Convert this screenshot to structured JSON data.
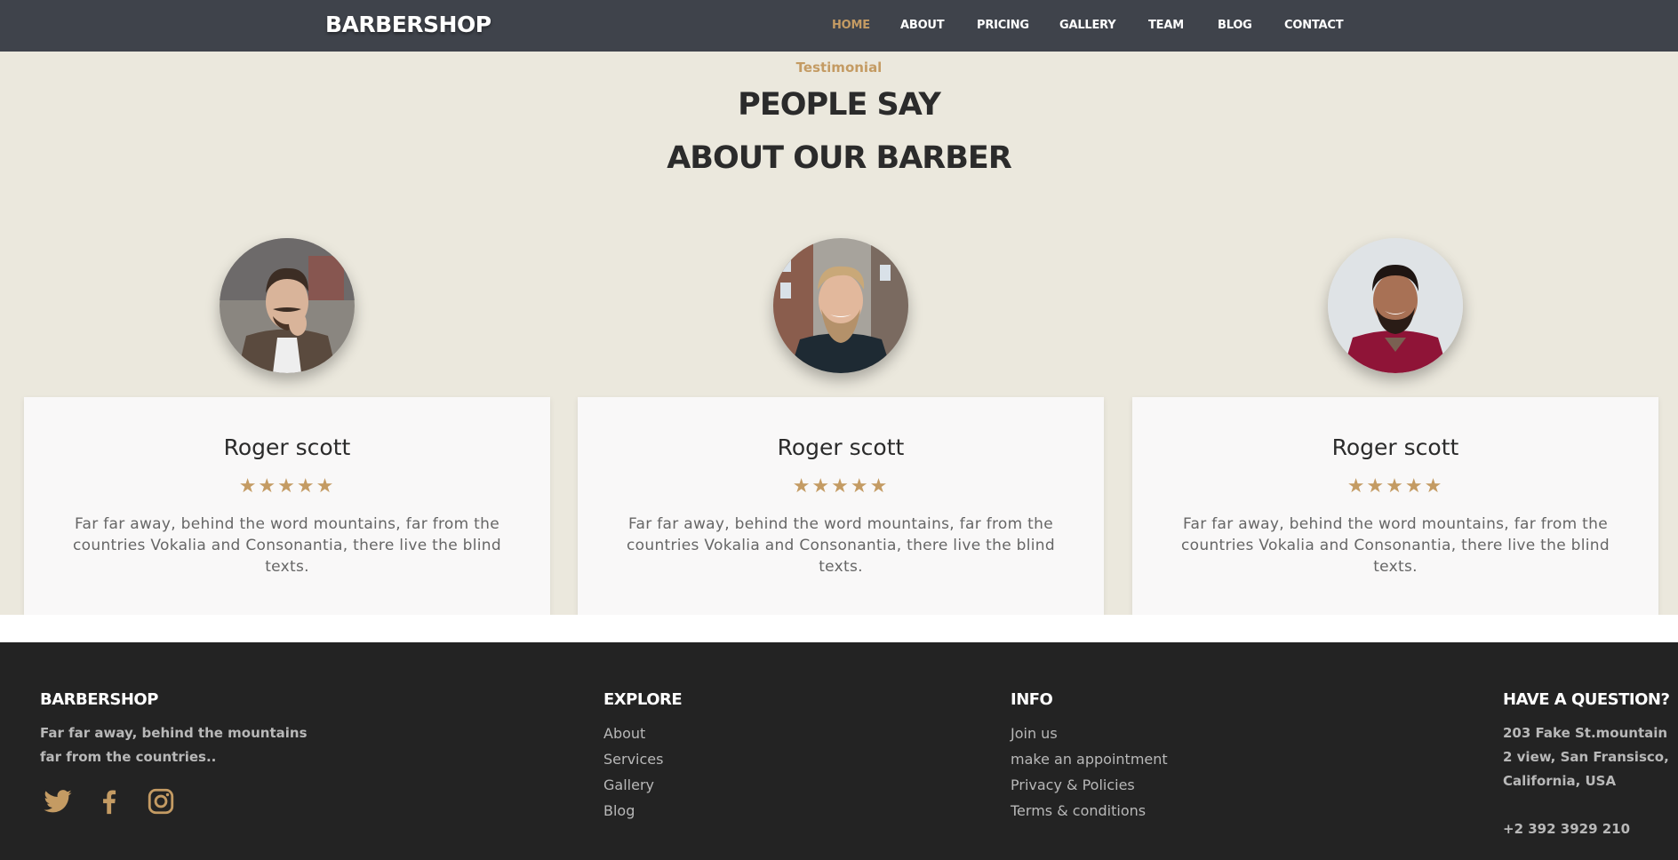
{
  "navbar": {
    "brand": "BARBERSHOP",
    "items": [
      {
        "label": "HOME",
        "active": true
      },
      {
        "label": "ABOUT",
        "active": false
      },
      {
        "label": "PRICING",
        "active": false
      },
      {
        "label": "GALLERY",
        "active": false
      },
      {
        "label": "TEAM",
        "active": false
      },
      {
        "label": "BLOG",
        "active": false
      },
      {
        "label": "CONTACT",
        "active": false
      }
    ]
  },
  "testimonials": {
    "subheading": "Testimonial",
    "heading_line1": "PEOPLE SAY",
    "heading_line2": "ABOUT OUR BARBER",
    "cards": [
      {
        "name": "Roger scott",
        "rating": 5,
        "stars": "★★★★★",
        "text": "Far far away, behind the word mountains, far from the countries Vokalia and Consonantia, there live the blind texts."
      },
      {
        "name": "Roger scott",
        "rating": 5,
        "stars": "★★★★★",
        "text": "Far far away, behind the word mountains, far from the countries Vokalia and Consonantia, there live the blind texts."
      },
      {
        "name": "Roger scott",
        "rating": 5,
        "stars": "★★★★★",
        "text": "Far far away, behind the word mountains, far from the countries Vokalia and Consonantia, there live the blind texts."
      }
    ]
  },
  "footer": {
    "about": {
      "title": "BARBERSHOP",
      "line1": "Far far away, behind the mountains",
      "line2": "far from the countries..",
      "social": [
        "twitter-icon",
        "facebook-icon",
        "instagram-icon"
      ]
    },
    "explore": {
      "title": "EXPLORE",
      "links": [
        "About",
        "Services",
        "Gallery",
        "Blog"
      ]
    },
    "info": {
      "title": "INFO",
      "links": [
        "Join us",
        "make an appointment",
        "Privacy & Policies",
        "Terms & conditions"
      ]
    },
    "contact": {
      "title": "HAVE A QUESTION?",
      "address_line1": "203 Fake St.mountain",
      "address_line2": "2 view, San Fransisco,",
      "address_line3": "California, USA",
      "phone": "+2 392 3929 210"
    }
  },
  "colors": {
    "accent": "#c49b63",
    "navbar_bg": "#3f434b",
    "section_bg": "#ebe8dd",
    "card_bg": "#f9f8f8",
    "footer_bg": "#232323"
  }
}
